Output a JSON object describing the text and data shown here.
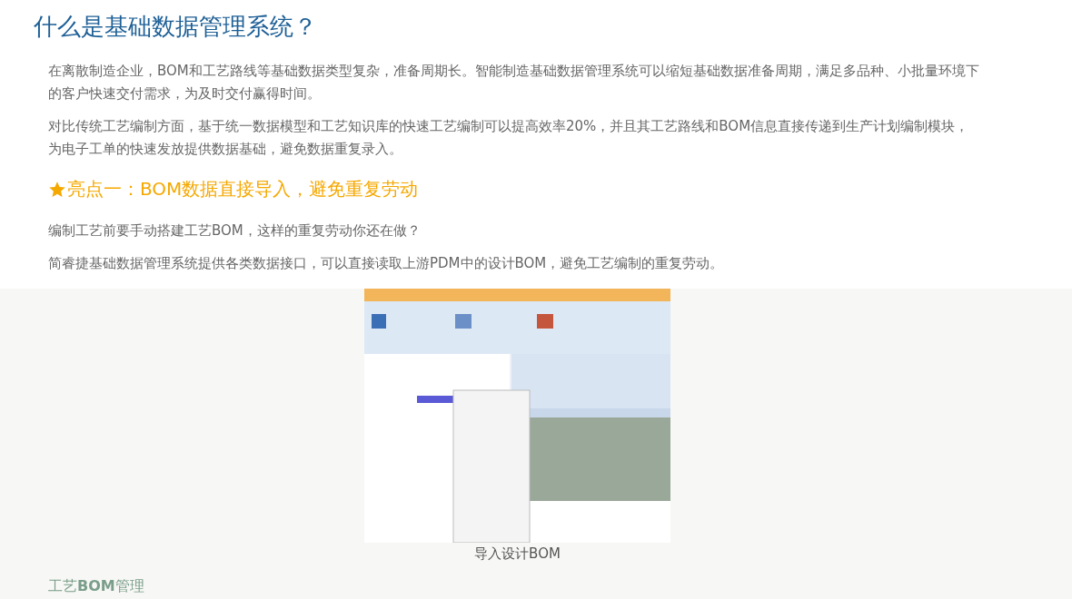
{
  "title": "什么是基础数据管理系统？",
  "paragraphs": [
    "在离散制造企业，BOM和工艺路线等基础数据类型复杂，准备周期长。智能制造基础数据管理系统可以缩短基础数据准备周期，满足多品种、小批量环境下的客户快速交付需求，为及时交付赢得时间。",
    "对比传统工艺编制方面，基于统一数据模型和工艺知识库的快速工艺编制可以提高效率20%，并且其工艺路线和BOM信息直接传递到生产计划编制模块，为电子工单的快速发放提供数据基础，避免数据重复录入。"
  ],
  "highlight": {
    "heading": "亮点一：BOM数据直接导入，避免重复劳动",
    "paragraphs": [
      "编制工艺前要手动搭建工艺BOM，这样的重复劳动你还在做？",
      "简睿捷基础数据管理系统提供各类数据接口，可以直接读取上游PDM中的设计BOM，避免工艺编制的重复劳动。"
    ]
  },
  "figure": {
    "kind": "picture",
    "caption": "导入设计BOM"
  },
  "next_heading": "工艺**BOM**管理"
}
